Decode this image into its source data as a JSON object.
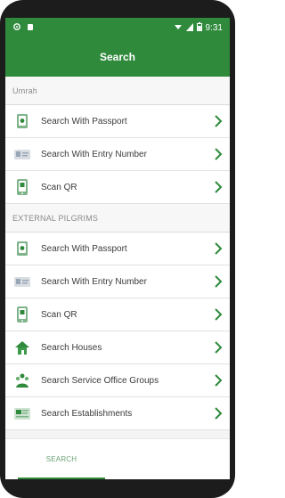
{
  "status_bar": {
    "time": "9:31"
  },
  "app_bar": {
    "title": "Search"
  },
  "sections": [
    {
      "header": "Umrah",
      "items": [
        {
          "label": "Search With Passport",
          "icon": "passport-icon"
        },
        {
          "label": "Search With Entry Number",
          "icon": "id-card-icon"
        },
        {
          "label": "Scan QR",
          "icon": "qr-scan-icon"
        }
      ]
    },
    {
      "header": "EXTERNAL PILGRIMS",
      "items": [
        {
          "label": "Search With Passport",
          "icon": "passport-icon"
        },
        {
          "label": "Search With Entry Number",
          "icon": "id-card-icon"
        },
        {
          "label": "Scan QR",
          "icon": "qr-scan-icon"
        },
        {
          "label": "Search Houses",
          "icon": "house-icon"
        },
        {
          "label": "Search Service Office Groups",
          "icon": "group-icon"
        },
        {
          "label": "Search Establishments",
          "icon": "establishment-icon"
        }
      ]
    }
  ],
  "tab_bar": {
    "tabs": [
      {
        "label": "SEARCH",
        "active": true
      },
      {
        "label": "",
        "active": false
      }
    ]
  },
  "colors": {
    "primary": "#2f8a3c",
    "text": "#3a3a3a",
    "chevron": "#2f8a3c"
  }
}
